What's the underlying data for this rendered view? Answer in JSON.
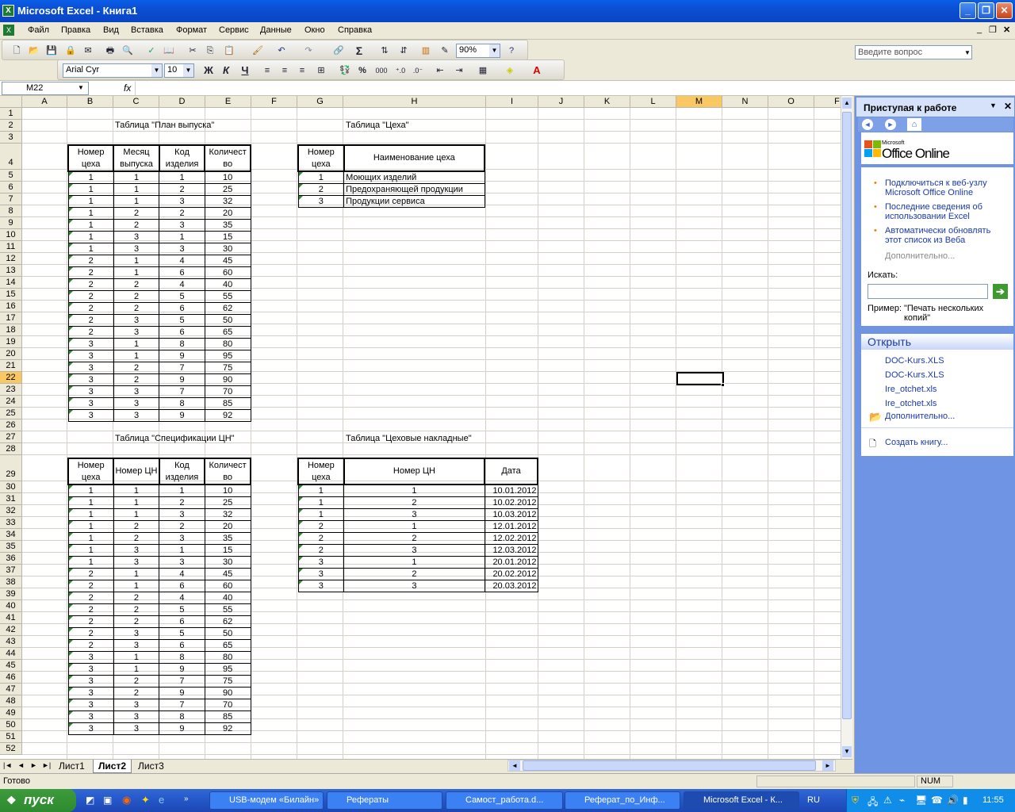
{
  "window": {
    "title": "Microsoft Excel - Книга1",
    "icon": "excel-icon"
  },
  "menu": [
    "Файл",
    "Правка",
    "Вид",
    "Вставка",
    "Формат",
    "Сервис",
    "Данные",
    "Окно",
    "Справка"
  ],
  "help_placeholder": "Введите вопрос",
  "toolbar": {
    "zoom": "90%",
    "font": "Arial Cyr",
    "size": "10",
    "bold": "Ж",
    "italic": "К",
    "underline": "Ч",
    "percent": "%",
    "thousands": "000"
  },
  "formula": {
    "namebox": "M22",
    "fx": "fx",
    "value": ""
  },
  "columns": [
    "A",
    "B",
    "C",
    "D",
    "E",
    "F",
    "G",
    "H",
    "I",
    "J",
    "K",
    "L",
    "M",
    "N",
    "O",
    "F"
  ],
  "rows": [
    "1",
    "2",
    "3",
    "4",
    "5",
    "6",
    "7",
    "8",
    "9",
    "10",
    "11",
    "12",
    "13",
    "14",
    "15",
    "16",
    "17",
    "18",
    "19",
    "20",
    "21",
    "22",
    "23",
    "24",
    "25",
    "26",
    "27",
    "28",
    "29",
    "30",
    "31",
    "32",
    "33",
    "34",
    "35",
    "36",
    "37",
    "38",
    "39",
    "40",
    "41",
    "42",
    "43",
    "44",
    "45",
    "46",
    "47",
    "48",
    "49",
    "50",
    "51",
    "52"
  ],
  "tables": {
    "plan": {
      "title": "Таблица \"План выпуска\"",
      "headers": [
        "Номер цеха",
        "Месяц выпуска",
        "Код изделия",
        "Количест во"
      ],
      "rows": [
        [
          "1",
          "1",
          "1",
          "10"
        ],
        [
          "1",
          "1",
          "2",
          "25"
        ],
        [
          "1",
          "1",
          "3",
          "32"
        ],
        [
          "1",
          "2",
          "2",
          "20"
        ],
        [
          "1",
          "2",
          "3",
          "35"
        ],
        [
          "1",
          "3",
          "1",
          "15"
        ],
        [
          "1",
          "3",
          "3",
          "30"
        ],
        [
          "2",
          "1",
          "4",
          "45"
        ],
        [
          "2",
          "1",
          "6",
          "60"
        ],
        [
          "2",
          "2",
          "4",
          "40"
        ],
        [
          "2",
          "2",
          "5",
          "55"
        ],
        [
          "2",
          "2",
          "6",
          "62"
        ],
        [
          "2",
          "3",
          "5",
          "50"
        ],
        [
          "2",
          "3",
          "6",
          "65"
        ],
        [
          "3",
          "1",
          "8",
          "80"
        ],
        [
          "3",
          "1",
          "9",
          "95"
        ],
        [
          "3",
          "2",
          "7",
          "75"
        ],
        [
          "3",
          "2",
          "9",
          "90"
        ],
        [
          "3",
          "3",
          "7",
          "70"
        ],
        [
          "3",
          "3",
          "8",
          "85"
        ],
        [
          "3",
          "3",
          "9",
          "92"
        ]
      ]
    },
    "shops": {
      "title": "Таблица \"Цеха\"",
      "headers": [
        "Номер цеха",
        "Наименование цеха"
      ],
      "rows": [
        [
          "1",
          "Моющих изделий"
        ],
        [
          "2",
          "Предохраняющей продукции"
        ],
        [
          "3",
          "Продукции сервиса"
        ]
      ]
    },
    "spec": {
      "title": "Таблица \"Спецификации ЦН\"",
      "headers": [
        "Номер цеха",
        "Номер ЦН",
        "Код изделия",
        "Количест во"
      ],
      "rows": [
        [
          "1",
          "1",
          "1",
          "10"
        ],
        [
          "1",
          "1",
          "2",
          "25"
        ],
        [
          "1",
          "1",
          "3",
          "32"
        ],
        [
          "1",
          "2",
          "2",
          "20"
        ],
        [
          "1",
          "2",
          "3",
          "35"
        ],
        [
          "1",
          "3",
          "1",
          "15"
        ],
        [
          "1",
          "3",
          "3",
          "30"
        ],
        [
          "2",
          "1",
          "4",
          "45"
        ],
        [
          "2",
          "1",
          "6",
          "60"
        ],
        [
          "2",
          "2",
          "4",
          "40"
        ],
        [
          "2",
          "2",
          "5",
          "55"
        ],
        [
          "2",
          "2",
          "6",
          "62"
        ],
        [
          "2",
          "3",
          "5",
          "50"
        ],
        [
          "2",
          "3",
          "6",
          "65"
        ],
        [
          "3",
          "1",
          "8",
          "80"
        ],
        [
          "3",
          "1",
          "9",
          "95"
        ],
        [
          "3",
          "2",
          "7",
          "75"
        ],
        [
          "3",
          "2",
          "9",
          "90"
        ],
        [
          "3",
          "3",
          "7",
          "70"
        ],
        [
          "3",
          "3",
          "8",
          "85"
        ],
        [
          "3",
          "3",
          "9",
          "92"
        ]
      ]
    },
    "invoices": {
      "title": "Таблица \"Цеховые накладные\"",
      "headers": [
        "Номер цеха",
        "Номер ЦН",
        "Дата"
      ],
      "rows": [
        [
          "1",
          "1",
          "10.01.2012"
        ],
        [
          "1",
          "2",
          "10.02.2012"
        ],
        [
          "1",
          "3",
          "10.03.2012"
        ],
        [
          "2",
          "1",
          "12.01.2012"
        ],
        [
          "2",
          "2",
          "12.02.2012"
        ],
        [
          "2",
          "3",
          "12.03.2012"
        ],
        [
          "3",
          "1",
          "20.01.2012"
        ],
        [
          "3",
          "2",
          "20.02.2012"
        ],
        [
          "3",
          "3",
          "20.03.2012"
        ]
      ]
    }
  },
  "sheets": [
    "Лист1",
    "Лист2",
    "Лист3"
  ],
  "active_sheet": "Лист2",
  "taskpane": {
    "title": "Приступая к работе",
    "logo_small": "Microsoft",
    "logo": "Office Online",
    "links": [
      "Подключиться к веб-узлу Microsoft Office Online",
      "Последние сведения об использовании Excel",
      "Автоматически обновлять этот список из Веба"
    ],
    "more": "Дополнительно...",
    "search_label": "Искать:",
    "example_label": "Пример:",
    "example": "\"Печать нескольких копий\"",
    "open_header": "Открыть",
    "files": [
      "DOC-Kurs.XLS",
      "DOC-Kurs.XLS",
      "Ire_otchet.xls",
      "Ire_otchet.xls"
    ],
    "open_more": "Дополнительно...",
    "create": "Создать книгу..."
  },
  "status": {
    "left": "Готово",
    "num": "NUM"
  },
  "taskbar": {
    "start": "пуск",
    "tasks": [
      "USB-модем «Билайн»",
      "Рефераты",
      "Самост_работа.d...",
      "Реферат_по_Инф...",
      "Microsoft Excel - К..."
    ],
    "lang": "RU",
    "time": "11:55"
  }
}
